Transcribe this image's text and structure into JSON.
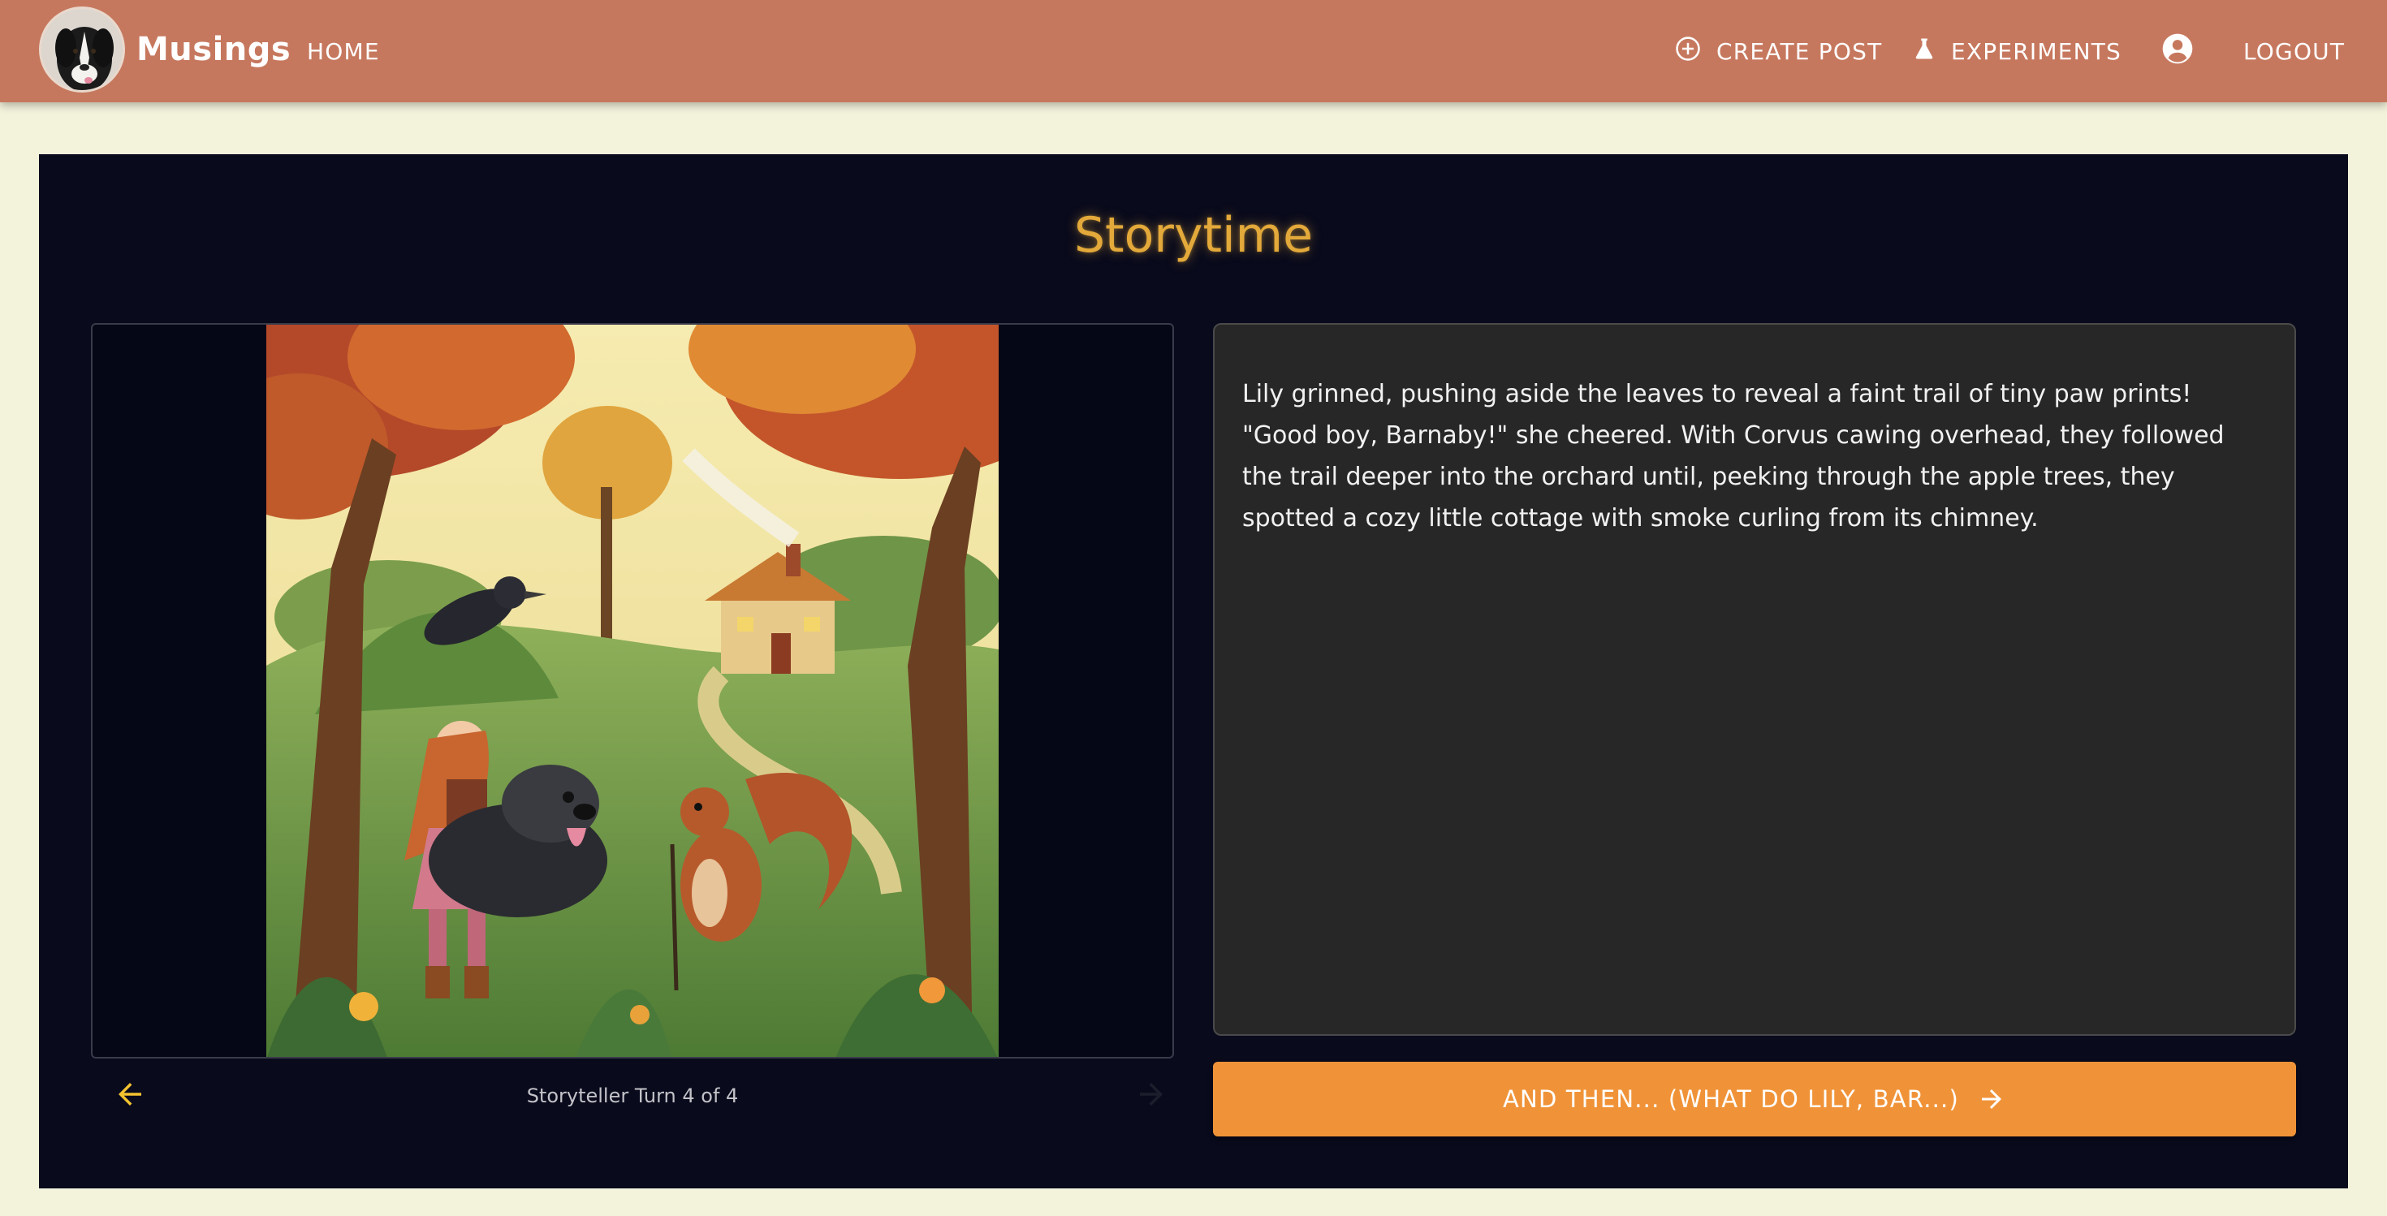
{
  "header": {
    "brand": "Musings",
    "nav": {
      "home": "HOME",
      "create_post": "CREATE POST",
      "experiments": "EXPERIMENTS",
      "logout": "LOGOUT"
    },
    "icons": {
      "avatar": "dog-avatar",
      "create_post": "add-circle-icon",
      "experiments": "flask-icon",
      "account": "account-circle-icon"
    },
    "colors": {
      "bar": "#c6785e",
      "text": "#ffffff"
    }
  },
  "main": {
    "title": "Storytime",
    "story_text": "Lily grinned, pushing aside the leaves to reveal a faint trail of tiny paw prints! \"Good boy, Barnaby!\" she cheered. With Corvus cawing overhead, they followed the trail deeper into the orchard until, peeking through the apple trees, they spotted a cozy little cottage with smoke curling from its chimney.",
    "navigation": {
      "turn_label": "Storyteller Turn 4 of 4",
      "back_icon": "arrow-left-icon",
      "forward_icon": "arrow-right-icon"
    },
    "next_button": {
      "label": "AND THEN... (WHAT DO LILY, BAR...)",
      "icon": "arrow-right-icon"
    },
    "colors": {
      "background": "#090a1c",
      "title": "#e3a93a",
      "panel": "#272727",
      "button": "#f09338",
      "nav_arrow": "#f2c230"
    }
  }
}
